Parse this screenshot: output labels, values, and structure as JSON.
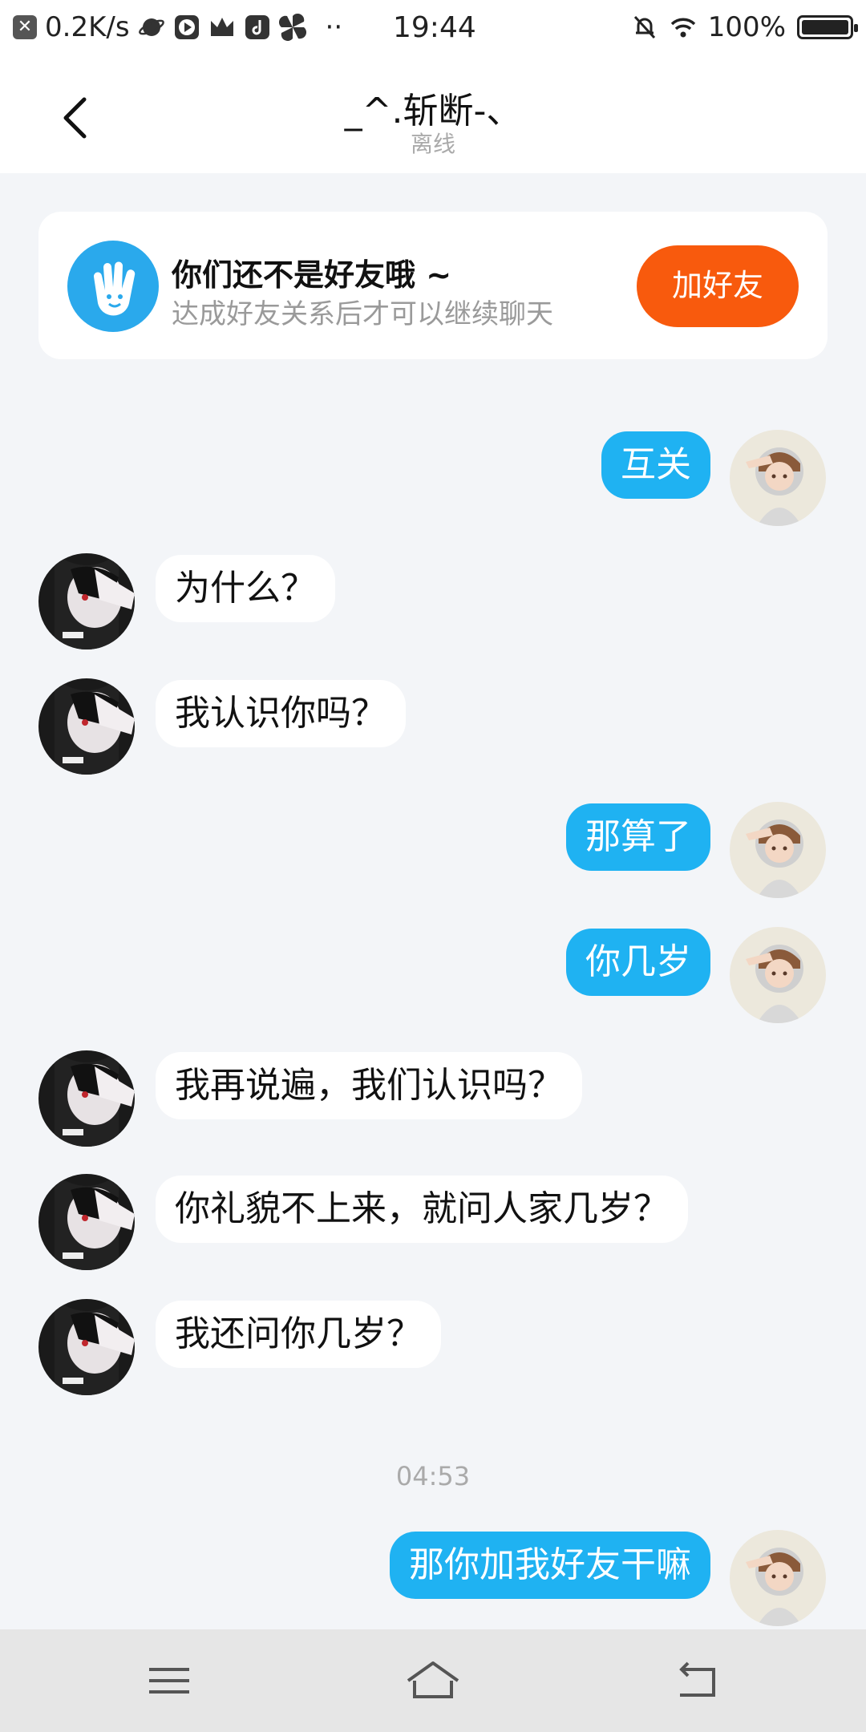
{
  "status_bar": {
    "net_speed": "0.2K/s",
    "time": "19:44",
    "battery": "100%",
    "dots": "··"
  },
  "header": {
    "title": "_^.斩断-、",
    "subtitle": "离线"
  },
  "friend_card": {
    "title": "你们还不是好友哦 ~",
    "subtitle": "达成好友关系后才可以继续聊天",
    "button": "加好友"
  },
  "messages": [
    {
      "side": "out",
      "text": "互关"
    },
    {
      "side": "in",
      "text": "为什么？"
    },
    {
      "side": "in",
      "text": "我认识你吗？"
    },
    {
      "side": "out",
      "text": "那算了"
    },
    {
      "side": "out",
      "text": "你几岁"
    },
    {
      "side": "in",
      "text": "我再说遍，我们认识吗？"
    },
    {
      "side": "in",
      "text": "你礼貌不上来，就问人家几岁？"
    },
    {
      "side": "in",
      "text": "我还问你几岁？"
    },
    {
      "side": "out",
      "text": "那你加我好友干嘛"
    }
  ],
  "timestamp": "04:53",
  "colors": {
    "accent_blue": "#1fb2f2",
    "add_orange": "#f85a0d",
    "background": "#f3f5f8"
  }
}
